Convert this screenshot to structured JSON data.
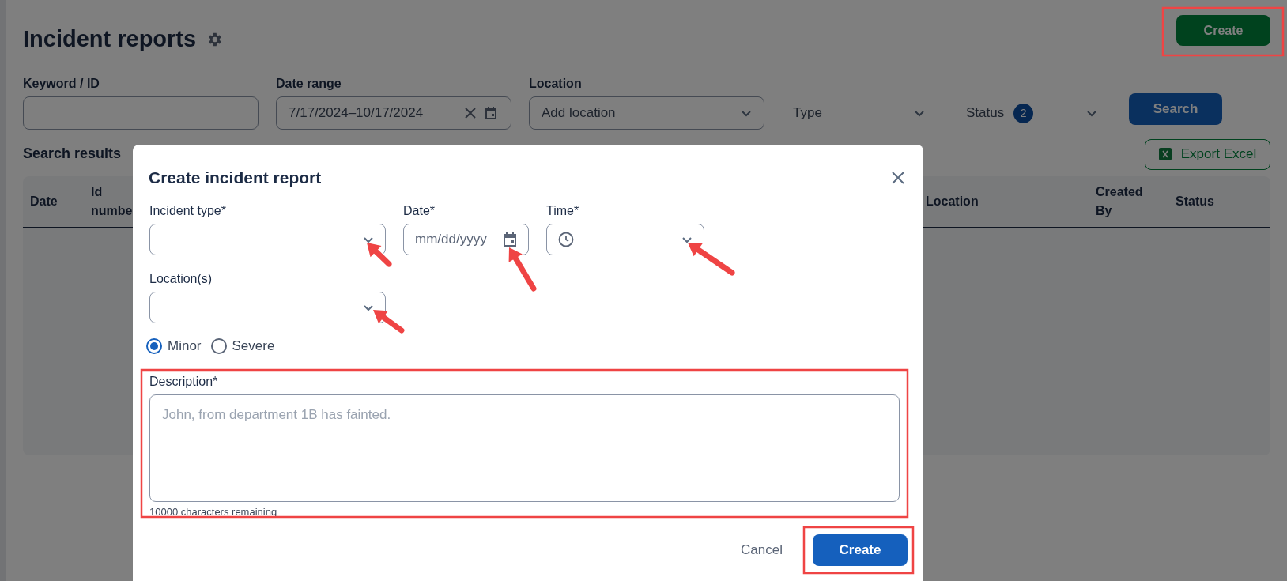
{
  "page": {
    "title": "Incident reports",
    "create_button": "Create"
  },
  "filters": {
    "keyword": {
      "label": "Keyword / ID"
    },
    "date_range": {
      "label": "Date range",
      "value": "7/17/2024–10/17/2024"
    },
    "location": {
      "label": "Location",
      "placeholder": "Add location"
    },
    "type": {
      "label": "Type"
    },
    "status": {
      "label": "Status",
      "badge": "2"
    },
    "search_button": "Search"
  },
  "results": {
    "title": "Search results",
    "export_button": "Export Excel",
    "columns": [
      {
        "label": "Date"
      },
      {
        "label": "Id numbe"
      },
      {
        "label": "Location"
      },
      {
        "label": "Created By"
      },
      {
        "label": "Status"
      }
    ]
  },
  "dialog": {
    "title": "Create incident report",
    "fields": [
      {
        "kind": "select",
        "label": "Incident type*"
      },
      {
        "kind": "date",
        "label": "Date*",
        "placeholder": "mm/dd/yyyy"
      },
      {
        "kind": "time",
        "label": "Time*"
      },
      {
        "kind": "select",
        "label": "Location(s)"
      }
    ],
    "severity": [
      {
        "label": "Minor",
        "selected": true
      },
      {
        "label": "Severe",
        "selected": false
      }
    ],
    "description": {
      "label": "Description*",
      "placeholder": "John, from department 1B has fainted.",
      "counter": "10000 characters remaining"
    },
    "cancel_button": "Cancel",
    "create_button": "Create"
  }
}
